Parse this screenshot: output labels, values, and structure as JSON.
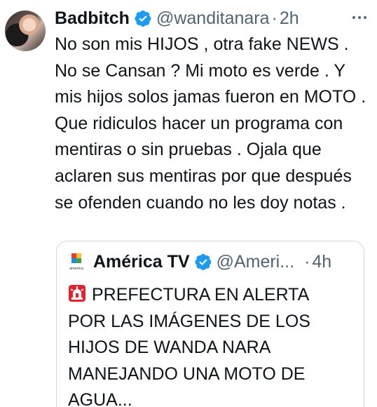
{
  "tweet": {
    "author_name": "Badbitch",
    "handle": "@wanditanara",
    "separator": "·",
    "time": "2h",
    "text": "No son mis HIJOS  , otra fake NEWS . No se Cansan ? Mi moto es verde . Y mis hijos solos jamas fueron en MOTO . Que ridiculos hacer un programa con mentiras o sin pruebas . Ojala que aclaren sus mentiras por que después se ofenden cuando no les doy notas ."
  },
  "quoted_tweet": {
    "author_name": "América TV",
    "handle": "@Ameri...",
    "separator": "·",
    "time": "4h",
    "logo_caption": "america",
    "text": "PREFECTURA EN ALERTA POR LAS IMÁGENES DE LOS HIJOS DE WANDA NARA MANEJANDO UNA MOTO DE AGUA..."
  },
  "icons": {
    "verified": "verified-badge-icon",
    "more": "more-options-icon",
    "siren": "police-siren-icon",
    "logo": "america-tv-logo"
  },
  "colors": {
    "text": "#0f1419",
    "secondary": "#536471",
    "verified_blue": "#1d9bf0",
    "border": "#cfd9de",
    "siren_red": "#e0242f"
  }
}
